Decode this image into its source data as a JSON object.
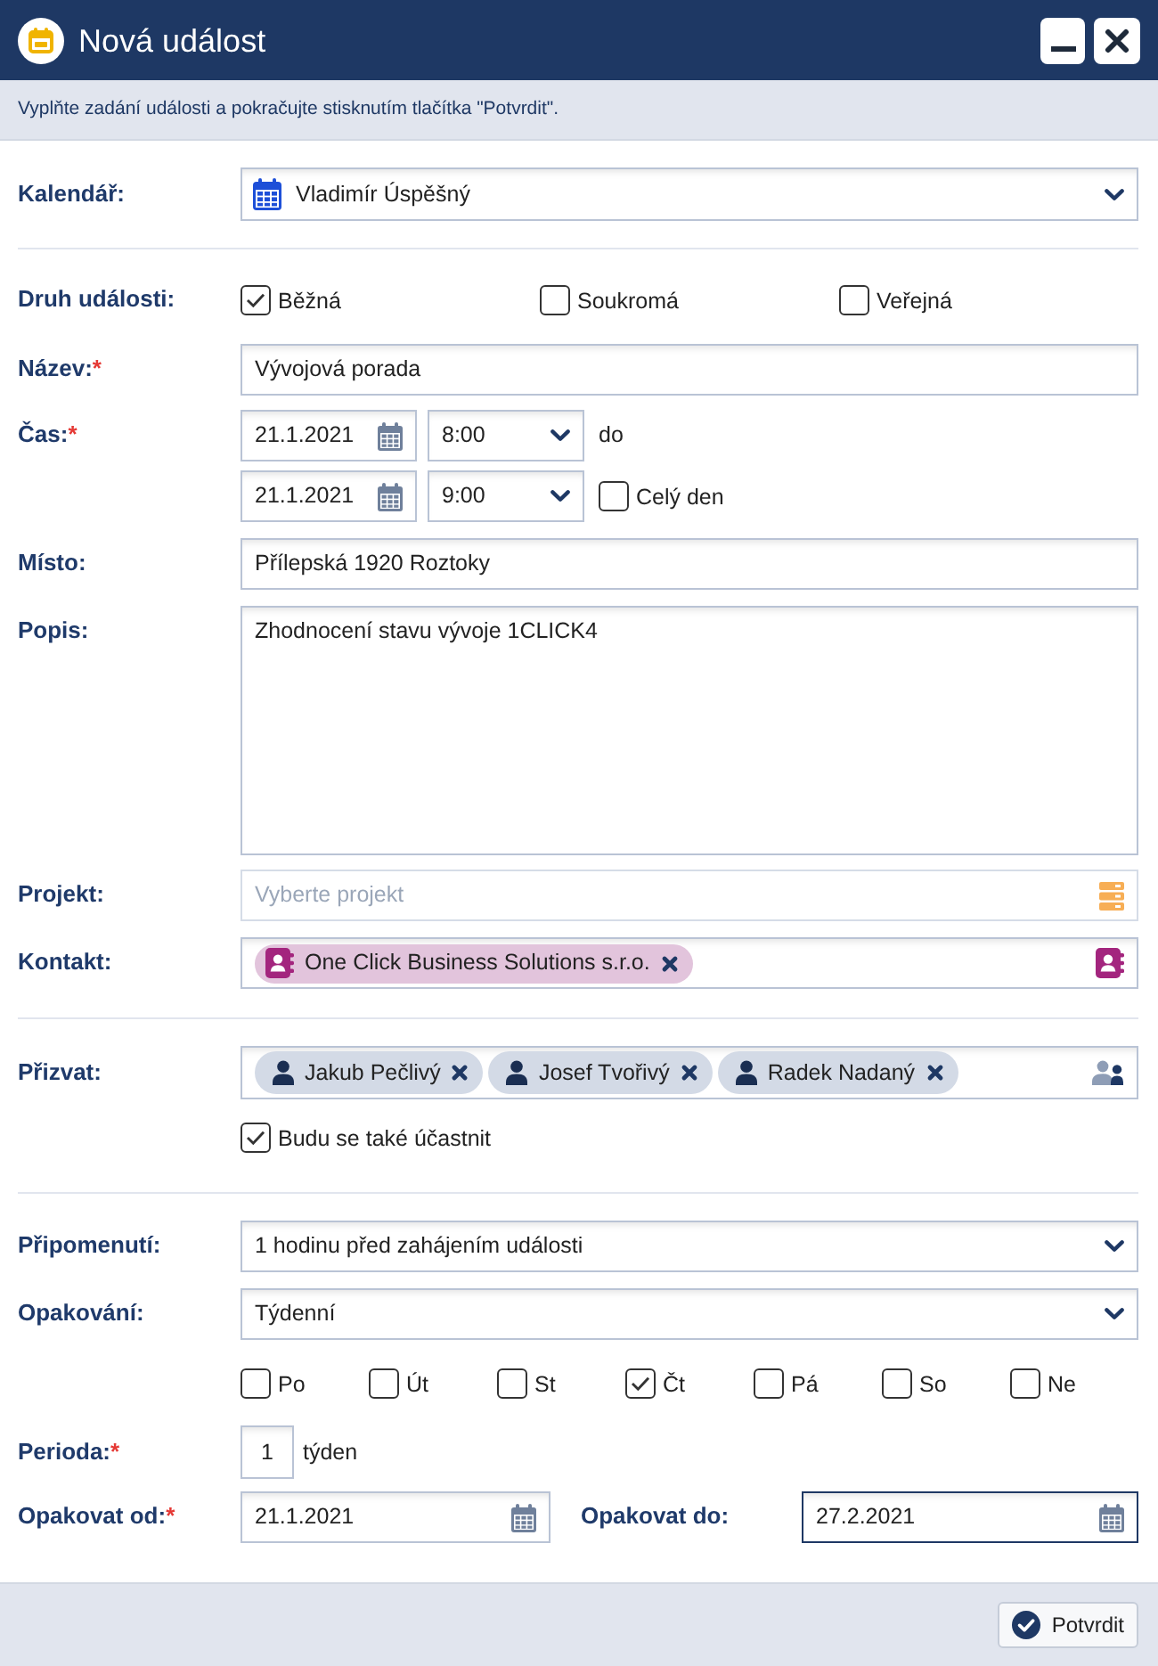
{
  "window": {
    "title": "Nová událost"
  },
  "instructions": "Vyplňte zadání události a pokračujte stisknutím tlačítka \"Potvrdit\".",
  "calendar": {
    "label": "Kalendář:",
    "value": "Vladimír Úspěšný"
  },
  "event_type": {
    "label": "Druh události:",
    "options": [
      {
        "label": "Běžná",
        "checked": true
      },
      {
        "label": "Soukromá",
        "checked": false
      },
      {
        "label": "Veřejná",
        "checked": false
      }
    ]
  },
  "title_field": {
    "label": "Název:",
    "required_mark": "*",
    "value": "Vývojová porada"
  },
  "time": {
    "label": "Čas:",
    "required_mark": "*",
    "start_date": "21.1.2021",
    "start_time": "8:00",
    "separator": "do",
    "end_date": "21.1.2021",
    "end_time": "9:00",
    "all_day": {
      "label": "Celý den",
      "checked": false
    }
  },
  "place": {
    "label": "Místo:",
    "value": "Přílepská 1920 Roztoky"
  },
  "description": {
    "label": "Popis:",
    "value": "Zhodnocení stavu vývoje 1CLICK4"
  },
  "project": {
    "label": "Projekt:",
    "placeholder": "Vyberte projekt"
  },
  "contact": {
    "label": "Kontakt:",
    "tags": [
      {
        "label": "One Click Business Solutions s.r.o."
      }
    ]
  },
  "invite": {
    "label": "Přizvat:",
    "tags": [
      {
        "label": "Jakub Pečlivý"
      },
      {
        "label": "Josef Tvořivý"
      },
      {
        "label": "Radek Nadaný"
      }
    ],
    "attend": {
      "label": "Budu se také účastnit",
      "checked": true
    }
  },
  "reminder": {
    "label": "Připomenutí:",
    "value": "1 hodinu před zahájením události"
  },
  "repeat": {
    "label": "Opakování:",
    "value": "Týdenní",
    "days": [
      {
        "label": "Po",
        "checked": false
      },
      {
        "label": "Út",
        "checked": false
      },
      {
        "label": "St",
        "checked": false
      },
      {
        "label": "Čt",
        "checked": true
      },
      {
        "label": "Pá",
        "checked": false
      },
      {
        "label": "So",
        "checked": false
      },
      {
        "label": "Ne",
        "checked": false
      }
    ]
  },
  "period": {
    "label": "Perioda:",
    "required_mark": "*",
    "value": "1",
    "unit": "týden"
  },
  "repeat_from": {
    "label": "Opakovat od:",
    "required_mark": "*",
    "value": "21.1.2021",
    "focused": false
  },
  "repeat_to": {
    "label": "Opakovat do:",
    "value": "27.2.2021",
    "focused": true
  },
  "footer": {
    "confirm_button": "Potvrdit"
  }
}
